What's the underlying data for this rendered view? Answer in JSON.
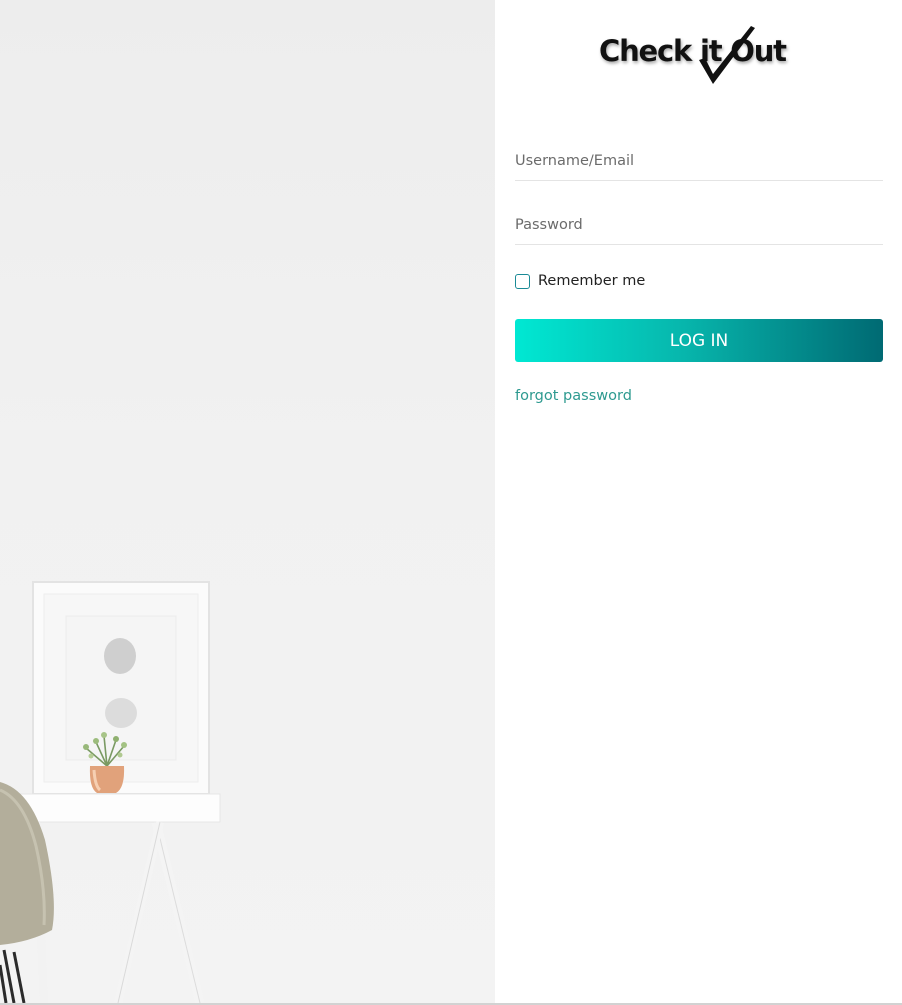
{
  "brand": {
    "logo_text": "Check it Out",
    "logo_icon": "checkmark-icon"
  },
  "form": {
    "username_placeholder": "Username/Email",
    "username_value": "",
    "password_placeholder": "Password",
    "password_value": "",
    "remember_label": "Remember me",
    "remember_checked": false,
    "login_label": "LOG IN",
    "forgot_label": "forgot password"
  },
  "colors": {
    "button_gradient_start": "#00e8d3",
    "button_gradient_end": "#006a73",
    "link": "#2e9a90",
    "checkbox_border": "#1a8a96"
  }
}
